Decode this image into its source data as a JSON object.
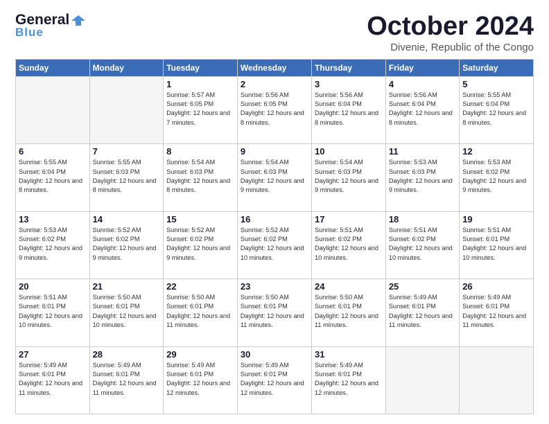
{
  "header": {
    "logo_general": "General",
    "logo_blue": "Blue",
    "month": "October 2024",
    "location": "Divenie, Republic of the Congo"
  },
  "weekdays": [
    "Sunday",
    "Monday",
    "Tuesday",
    "Wednesday",
    "Thursday",
    "Friday",
    "Saturday"
  ],
  "weeks": [
    [
      {
        "day": "",
        "info": ""
      },
      {
        "day": "",
        "info": ""
      },
      {
        "day": "1",
        "info": "Sunrise: 5:57 AM\nSunset: 6:05 PM\nDaylight: 12 hours and 7 minutes."
      },
      {
        "day": "2",
        "info": "Sunrise: 5:56 AM\nSunset: 6:05 PM\nDaylight: 12 hours and 8 minutes."
      },
      {
        "day": "3",
        "info": "Sunrise: 5:56 AM\nSunset: 6:04 PM\nDaylight: 12 hours and 8 minutes."
      },
      {
        "day": "4",
        "info": "Sunrise: 5:56 AM\nSunset: 6:04 PM\nDaylight: 12 hours and 8 minutes."
      },
      {
        "day": "5",
        "info": "Sunrise: 5:55 AM\nSunset: 6:04 PM\nDaylight: 12 hours and 8 minutes."
      }
    ],
    [
      {
        "day": "6",
        "info": "Sunrise: 5:55 AM\nSunset: 6:04 PM\nDaylight: 12 hours and 8 minutes."
      },
      {
        "day": "7",
        "info": "Sunrise: 5:55 AM\nSunset: 6:03 PM\nDaylight: 12 hours and 8 minutes."
      },
      {
        "day": "8",
        "info": "Sunrise: 5:54 AM\nSunset: 6:03 PM\nDaylight: 12 hours and 8 minutes."
      },
      {
        "day": "9",
        "info": "Sunrise: 5:54 AM\nSunset: 6:03 PM\nDaylight: 12 hours and 9 minutes."
      },
      {
        "day": "10",
        "info": "Sunrise: 5:54 AM\nSunset: 6:03 PM\nDaylight: 12 hours and 9 minutes."
      },
      {
        "day": "11",
        "info": "Sunrise: 5:53 AM\nSunset: 6:03 PM\nDaylight: 12 hours and 9 minutes."
      },
      {
        "day": "12",
        "info": "Sunrise: 5:53 AM\nSunset: 6:02 PM\nDaylight: 12 hours and 9 minutes."
      }
    ],
    [
      {
        "day": "13",
        "info": "Sunrise: 5:53 AM\nSunset: 6:02 PM\nDaylight: 12 hours and 9 minutes."
      },
      {
        "day": "14",
        "info": "Sunrise: 5:52 AM\nSunset: 6:02 PM\nDaylight: 12 hours and 9 minutes."
      },
      {
        "day": "15",
        "info": "Sunrise: 5:52 AM\nSunset: 6:02 PM\nDaylight: 12 hours and 9 minutes."
      },
      {
        "day": "16",
        "info": "Sunrise: 5:52 AM\nSunset: 6:02 PM\nDaylight: 12 hours and 10 minutes."
      },
      {
        "day": "17",
        "info": "Sunrise: 5:51 AM\nSunset: 6:02 PM\nDaylight: 12 hours and 10 minutes."
      },
      {
        "day": "18",
        "info": "Sunrise: 5:51 AM\nSunset: 6:02 PM\nDaylight: 12 hours and 10 minutes."
      },
      {
        "day": "19",
        "info": "Sunrise: 5:51 AM\nSunset: 6:01 PM\nDaylight: 12 hours and 10 minutes."
      }
    ],
    [
      {
        "day": "20",
        "info": "Sunrise: 5:51 AM\nSunset: 6:01 PM\nDaylight: 12 hours and 10 minutes."
      },
      {
        "day": "21",
        "info": "Sunrise: 5:50 AM\nSunset: 6:01 PM\nDaylight: 12 hours and 10 minutes."
      },
      {
        "day": "22",
        "info": "Sunrise: 5:50 AM\nSunset: 6:01 PM\nDaylight: 12 hours and 11 minutes."
      },
      {
        "day": "23",
        "info": "Sunrise: 5:50 AM\nSunset: 6:01 PM\nDaylight: 12 hours and 11 minutes."
      },
      {
        "day": "24",
        "info": "Sunrise: 5:50 AM\nSunset: 6:01 PM\nDaylight: 12 hours and 11 minutes."
      },
      {
        "day": "25",
        "info": "Sunrise: 5:49 AM\nSunset: 6:01 PM\nDaylight: 12 hours and 11 minutes."
      },
      {
        "day": "26",
        "info": "Sunrise: 5:49 AM\nSunset: 6:01 PM\nDaylight: 12 hours and 11 minutes."
      }
    ],
    [
      {
        "day": "27",
        "info": "Sunrise: 5:49 AM\nSunset: 6:01 PM\nDaylight: 12 hours and 11 minutes."
      },
      {
        "day": "28",
        "info": "Sunrise: 5:49 AM\nSunset: 6:01 PM\nDaylight: 12 hours and 11 minutes."
      },
      {
        "day": "29",
        "info": "Sunrise: 5:49 AM\nSunset: 6:01 PM\nDaylight: 12 hours and 12 minutes."
      },
      {
        "day": "30",
        "info": "Sunrise: 5:49 AM\nSunset: 6:01 PM\nDaylight: 12 hours and 12 minutes."
      },
      {
        "day": "31",
        "info": "Sunrise: 5:49 AM\nSunset: 6:01 PM\nDaylight: 12 hours and 12 minutes."
      },
      {
        "day": "",
        "info": ""
      },
      {
        "day": "",
        "info": ""
      }
    ]
  ]
}
